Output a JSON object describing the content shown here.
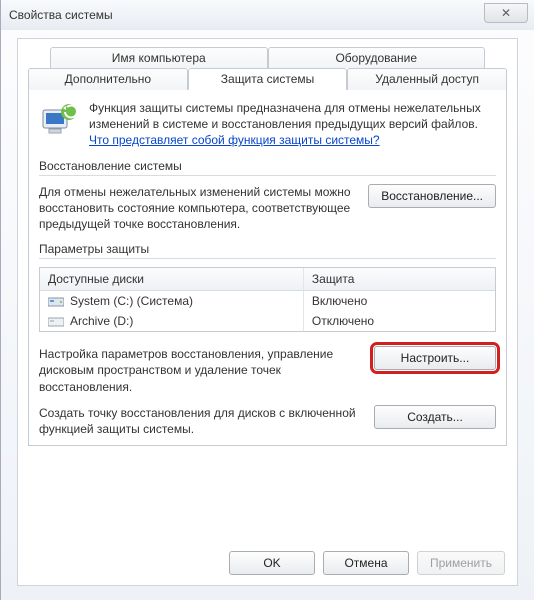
{
  "window": {
    "title": "Свойства системы"
  },
  "tabs": {
    "row1": [
      {
        "label": "Имя компьютера"
      },
      {
        "label": "Оборудование"
      }
    ],
    "row2": [
      {
        "label": "Дополнительно"
      },
      {
        "label": "Защита системы",
        "active": true
      },
      {
        "label": "Удаленный доступ"
      }
    ]
  },
  "intro": {
    "text": "Функция защиты системы предназначена для отмены нежелательных изменений в системе и восстановления предыдущих версий файлов. ",
    "link": "Что представляет собой функция защиты системы?"
  },
  "restore": {
    "legend": "Восстановление системы",
    "desc": "Для отмены нежелательных изменений системы можно восстановить состояние компьютера, соответствующее предыдущей точке восстановления.",
    "button": "Восстановление..."
  },
  "protection": {
    "legend": "Параметры защиты",
    "columns": {
      "drives": "Доступные диски",
      "status": "Защита"
    },
    "rows": [
      {
        "name": "System (C:) (Система)",
        "status": "Включено",
        "icon": "system"
      },
      {
        "name": "Archive (D:)",
        "status": "Отключено",
        "icon": "drive"
      }
    ],
    "configure": {
      "desc": "Настройка параметров восстановления, управление дисковым пространством и удаление точек восстановления.",
      "button": "Настроить..."
    },
    "create": {
      "desc": "Создать точку восстановления для дисков с включенной функцией защиты системы.",
      "button": "Создать..."
    }
  },
  "footer": {
    "ok": "OK",
    "cancel": "Отмена",
    "apply": "Применить"
  }
}
